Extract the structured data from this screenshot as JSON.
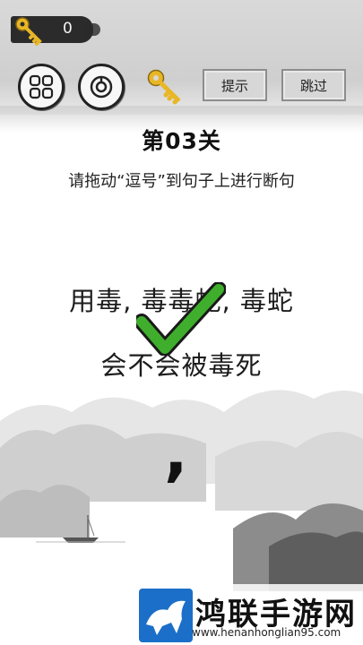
{
  "hud": {
    "key_count": "0"
  },
  "buttons": {
    "hint_label": "提示",
    "skip_label": "跳过"
  },
  "level": {
    "title": "第03关",
    "instruction": "请拖动“逗号”到句子上进行断句",
    "sentence_line1": "用毒, 毒毒蛇, 毒蛇",
    "sentence_line2": "会不会被毒死",
    "draggable_piece": ","
  },
  "result": {
    "state": "correct"
  },
  "watermark": {
    "title": "鸿联手游网",
    "url": "www.henanhonglian95.com"
  },
  "colors": {
    "key_gold": "#e9b627",
    "check_green": "#3fae2d",
    "ink": "#1c1c1c"
  },
  "icons": [
    "key-icon",
    "menu-grid-icon",
    "share-icon",
    "key-icon",
    "checkmark-icon"
  ]
}
